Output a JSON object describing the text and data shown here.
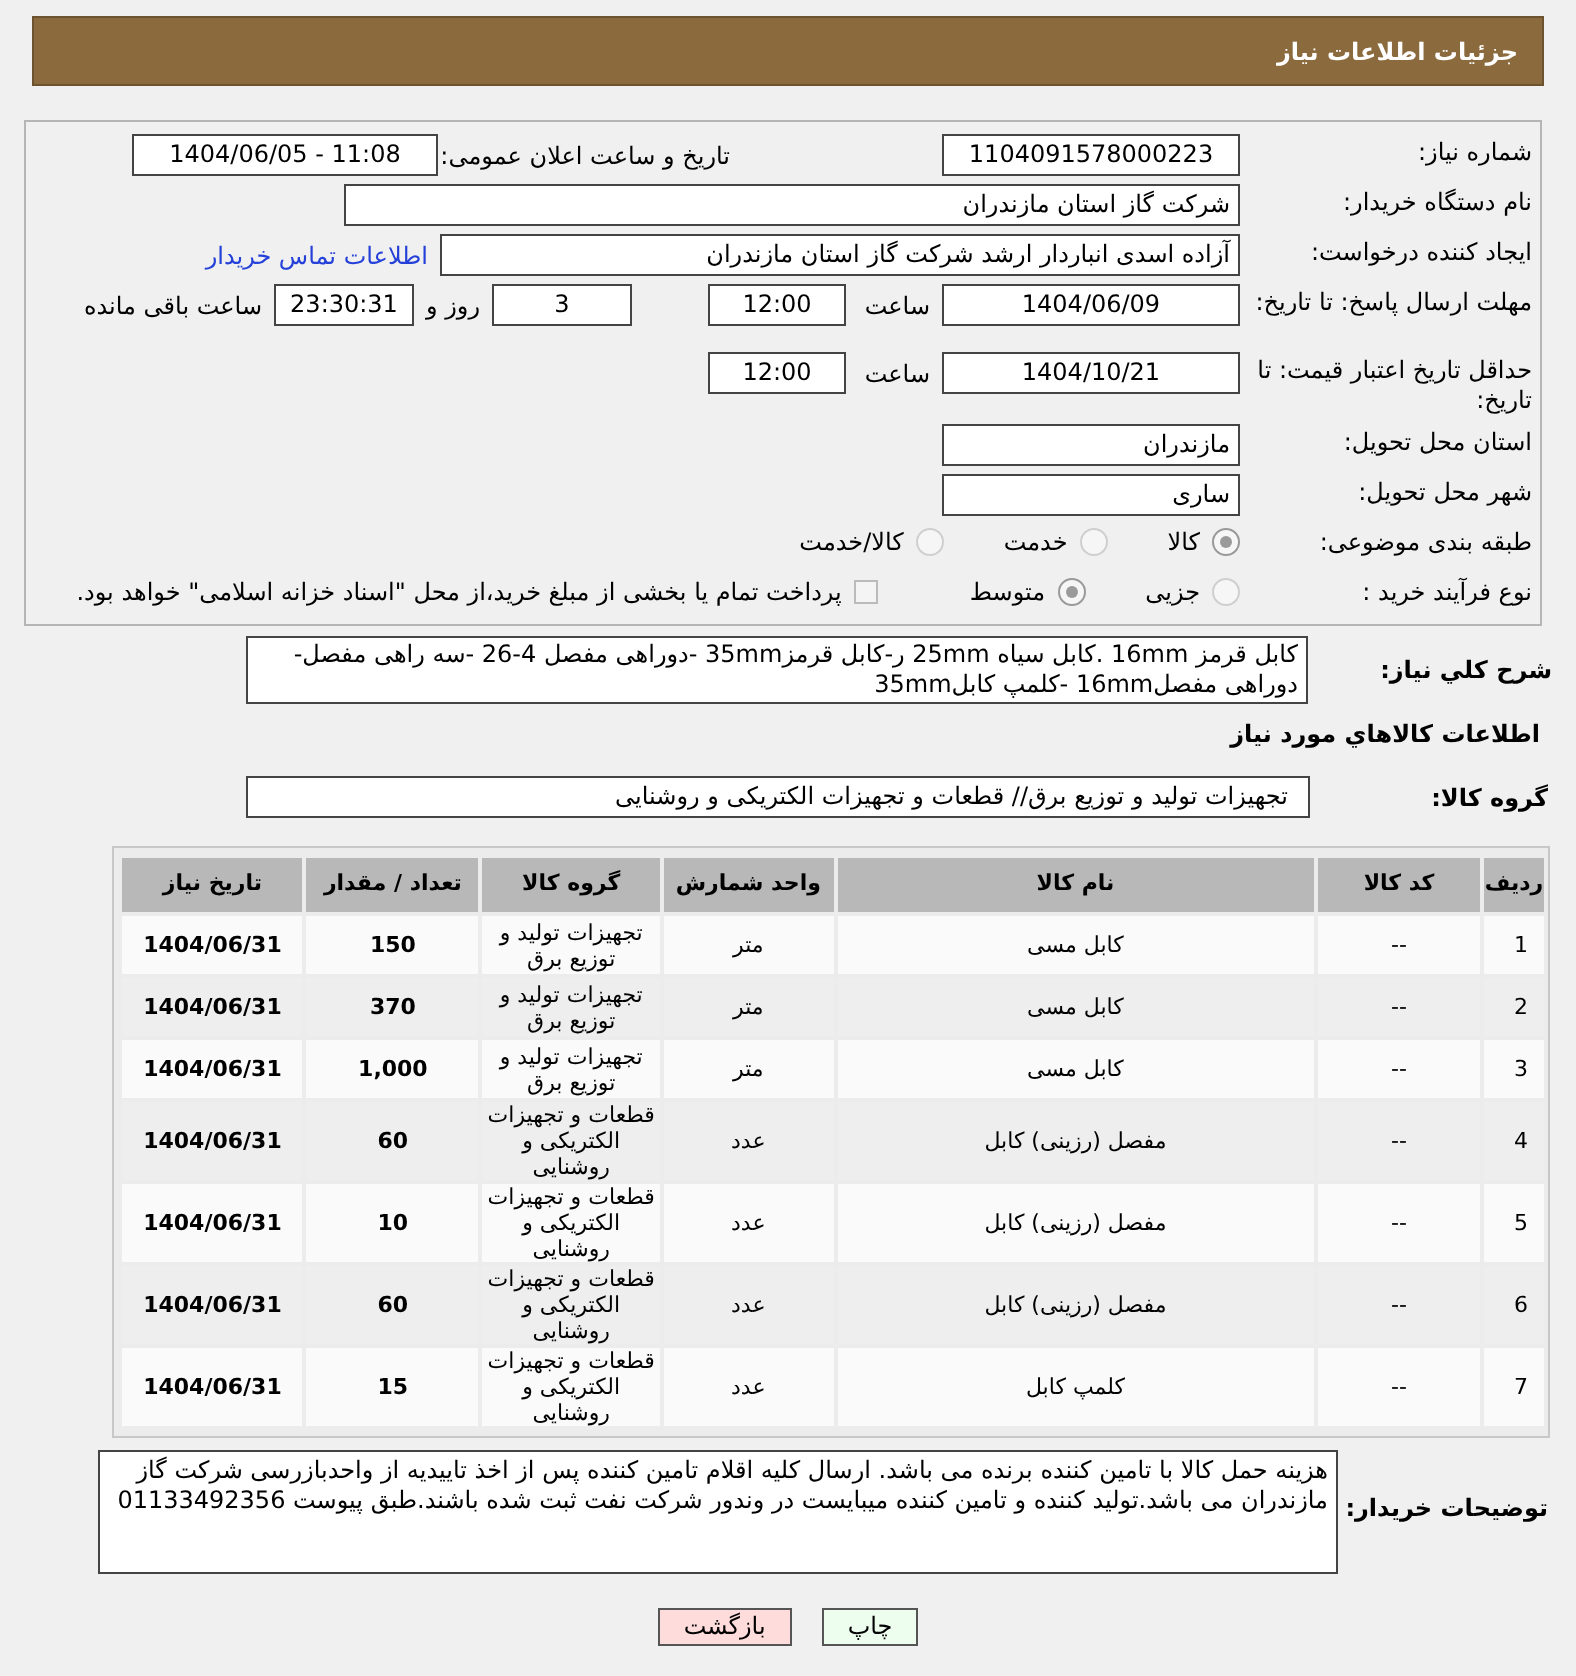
{
  "header": {
    "title": "جزئیات اطلاعات نیاز"
  },
  "need_number": {
    "label": "شماره نیاز:",
    "value": "1104091578000223"
  },
  "announce": {
    "label": "تاریخ و ساعت اعلان عمومی:",
    "value": "1404/06/05 - 11:08"
  },
  "buyer": {
    "label": "نام دستگاه خریدار:",
    "value": "شرکت گاز استان مازندران"
  },
  "requester": {
    "label": "ایجاد کننده درخواست:",
    "value": "آزاده اسدی انباردار ارشد شرکت گاز استان مازندران",
    "link": "اطلاعات تماس خریدار"
  },
  "deadline": {
    "label": "مهلت ارسال پاسخ: تا تاریخ:",
    "date": "1404/06/09",
    "time_label": "ساعت",
    "time": "12:00",
    "days": "3",
    "days_label": "روز و",
    "remaining": "23:30:31",
    "remaining_label": "ساعت باقی مانده"
  },
  "validity": {
    "label": "حداقل تاریخ اعتبار قیمت: تا تاریخ:",
    "date": "1404/10/21",
    "time_label": "ساعت",
    "time": "12:00"
  },
  "province": {
    "label": "استان محل تحویل:",
    "value": "مازندران"
  },
  "city": {
    "label": "شهر محل تحویل:",
    "value": "ساری"
  },
  "category": {
    "label": "طبقه بندی موضوعی:",
    "options": [
      {
        "label": "کالا",
        "selected": true
      },
      {
        "label": "خدمت",
        "selected": false
      },
      {
        "label": "کالا/خدمت",
        "selected": false
      }
    ]
  },
  "purchase_type": {
    "label": "نوع فرآیند خرید :",
    "options": [
      {
        "label": "جزیی",
        "selected": false
      },
      {
        "label": "متوسط",
        "selected": true
      }
    ],
    "payment_note": {
      "label": "پرداخت تمام یا بخشی از مبلغ خرید،از محل \"اسناد خزانه اسلامی\" خواهد بود.",
      "checked": false
    }
  },
  "description": {
    "label": "شرح کلي نياز:",
    "value": "کابل قرمز 16mm .کابل سیاه 25mm ر-کابل قرمز35mm -دوراهی مفصل 4-26 -سه راهی مفصل-دوراهی مفصل16mm -کلمپ کابل35mm"
  },
  "goods_heading": "اطلاعات کالاهاي مورد نياز",
  "goods_group": {
    "label": "گروه کالا:",
    "value": "تجهیزات تولید و توزیع برق// قطعات و تجهیزات الکتریکی و روشنایی"
  },
  "table": {
    "columns": [
      "ردیف",
      "کد کالا",
      "نام کالا",
      "واحد شمارش",
      "گروه کالا",
      "تعداد / مقدار",
      "تاریخ نیاز"
    ],
    "rows": [
      [
        "1",
        "--",
        "کابل مسی",
        "متر",
        "تجهیزات تولید و توزیع برق",
        "150",
        "1404/06/31"
      ],
      [
        "2",
        "--",
        "کابل مسی",
        "متر",
        "تجهیزات تولید و توزیع برق",
        "370",
        "1404/06/31"
      ],
      [
        "3",
        "--",
        "کابل مسی",
        "متر",
        "تجهیزات تولید و توزیع برق",
        "1,000",
        "1404/06/31"
      ],
      [
        "4",
        "--",
        "مفصل (رزینی) کابل",
        "عدد",
        "قطعات و تجهیزات الکتریکی و روشنایی",
        "60",
        "1404/06/31"
      ],
      [
        "5",
        "--",
        "مفصل (رزینی) کابل",
        "عدد",
        "قطعات و تجهیزات الکتریکی و روشنایی",
        "10",
        "1404/06/31"
      ],
      [
        "6",
        "--",
        "مفصل (رزینی) کابل",
        "عدد",
        "قطعات و تجهیزات الکتریکی و روشنایی",
        "60",
        "1404/06/31"
      ],
      [
        "7",
        "--",
        "کلمپ کابل",
        "عدد",
        "قطعات و تجهیزات الکتریکی و روشنایی",
        "15",
        "1404/06/31"
      ]
    ]
  },
  "notes": {
    "label": "توضیحات خریدار:",
    "value": "هزینه حمل کالا با تامین کننده برنده می باشد. ارسال کلیه اقلام تامین کننده پس از اخذ تاییدیه از واحدبازرسی شرکت گاز مازندران می باشد.تولید کننده و تامین کننده میبایست در وندور شرکت نفت ثبت شده باشند.طبق پیوست 01133492356"
  },
  "buttons": [
    {
      "label": "چاپ",
      "kind": "print"
    },
    {
      "label": "بازگشت",
      "kind": "back"
    }
  ]
}
